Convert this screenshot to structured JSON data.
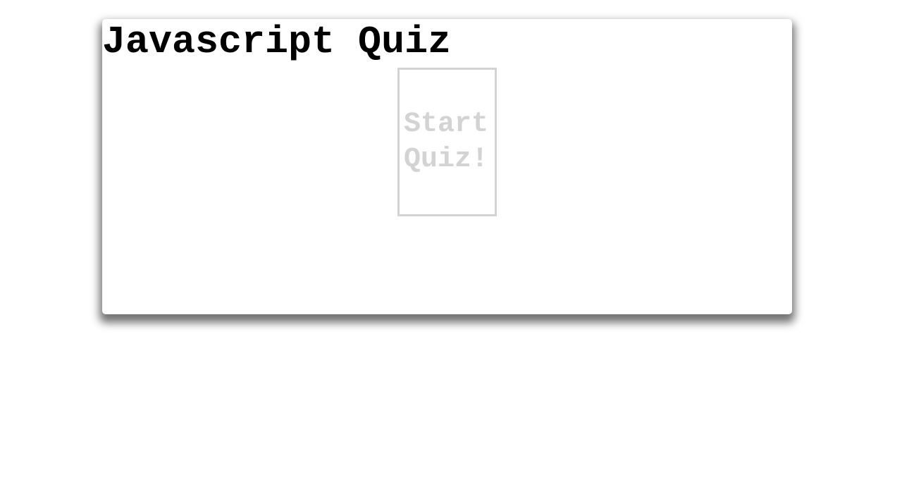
{
  "quiz": {
    "title": "Javascript Quiz",
    "start_button_line1": "Start",
    "start_button_line2": "Quiz!"
  },
  "colors": {
    "card_background": "#ffffff",
    "title_text": "#000000",
    "button_border": "#d3d3d3",
    "button_text": "#d3d3d3"
  }
}
